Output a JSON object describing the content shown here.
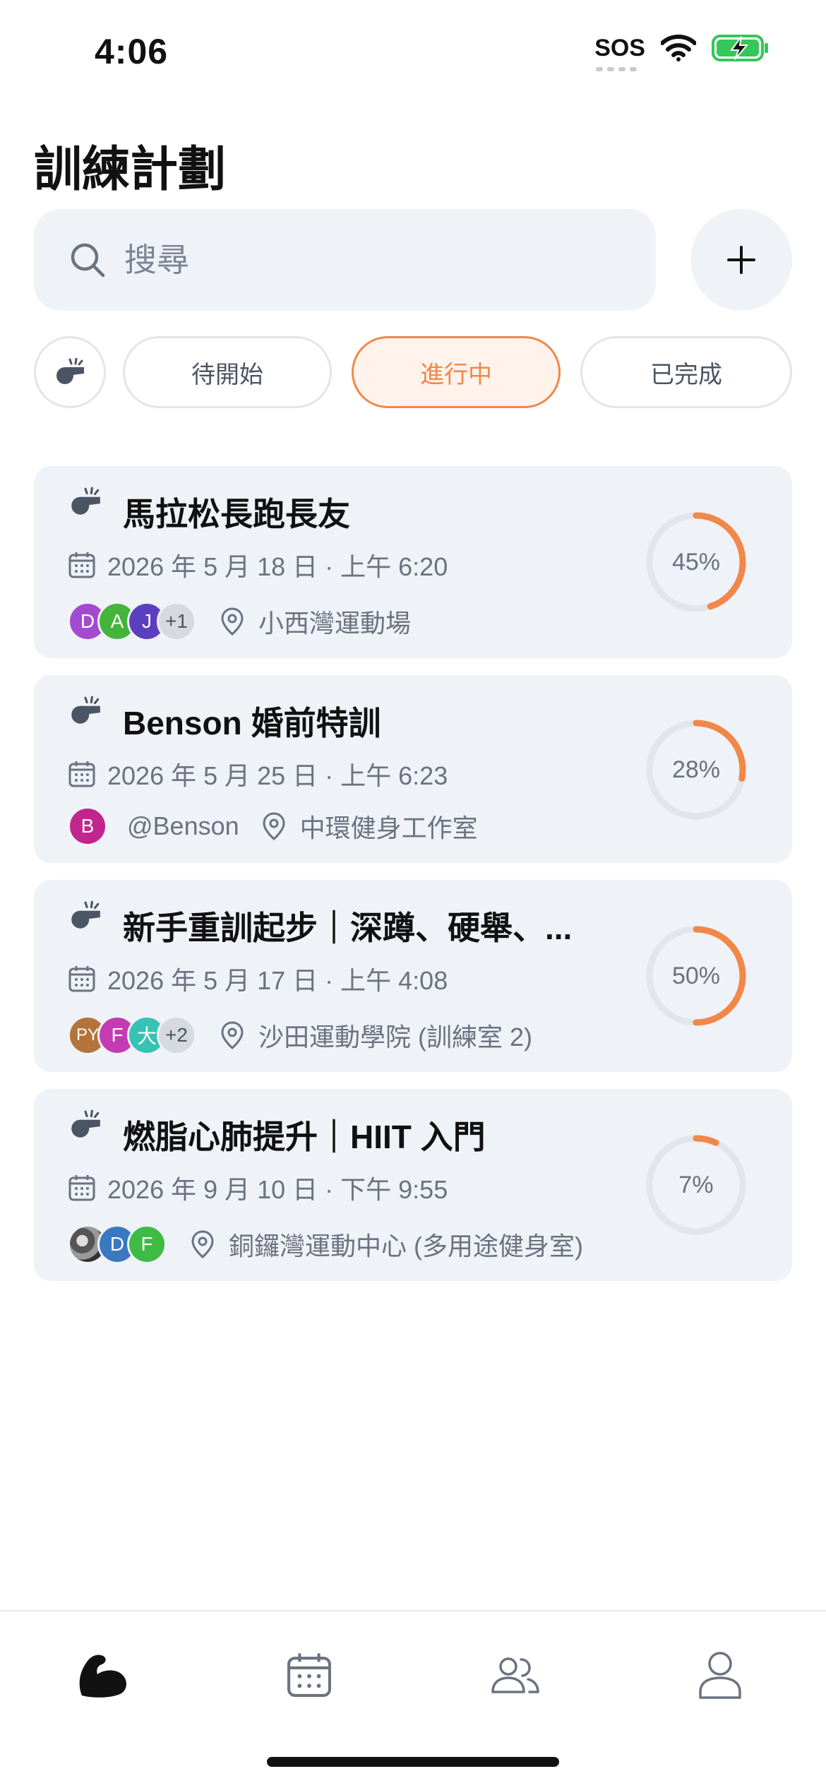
{
  "status_bar": {
    "time": "4:06",
    "sos": "SOS"
  },
  "page": {
    "title": "訓練計劃"
  },
  "search": {
    "placeholder": "搜尋",
    "value": ""
  },
  "filters": [
    {
      "label": "待開始",
      "active": false
    },
    {
      "label": "進行中",
      "active": true
    },
    {
      "label": "已完成",
      "active": false
    }
  ],
  "colors": {
    "accent": "#f2874a",
    "card_bg": "#eff2f7",
    "muted_text": "#6b7280",
    "ring_track": "#e2e5ea"
  },
  "plans": [
    {
      "title": "馬拉松長跑長友",
      "date": "2026 年 5 月 18 日 · 上午 6:20",
      "participants": [
        {
          "initial": "D",
          "color": "#a24bd0"
        },
        {
          "initial": "A",
          "color": "#45b43c"
        },
        {
          "initial": "J",
          "color": "#5c3fc0"
        }
      ],
      "more": "+1",
      "location": "小西灣運動場",
      "progress_label": "45%",
      "progress": 0.45
    },
    {
      "title": "Benson 婚前特訓",
      "date": "2026 年 5 月 25 日 · 上午 6:23",
      "participants": [
        {
          "initial": "B",
          "color": "#c0268e"
        }
      ],
      "handle": "@Benson",
      "location": "中環健身工作室",
      "progress_label": "28%",
      "progress": 0.28
    },
    {
      "title": "新手重訓起步｜深蹲、硬舉、...",
      "date": "2026 年 5 月 17 日 · 上午 4:08",
      "participants": [
        {
          "initial": "PY",
          "color": "#b3733a"
        },
        {
          "initial": "F",
          "color": "#c43bb3"
        },
        {
          "initial": "大",
          "color": "#36c2b4"
        }
      ],
      "more": "+2",
      "location": "沙田運動學院 (訓練室 2)",
      "progress_label": "50%",
      "progress": 0.5
    },
    {
      "title": "燃脂心肺提升｜HIIT 入門",
      "date": "2026 年 9 月 10 日 · 下午 9:55",
      "participants": [
        {
          "initial": "",
          "color": "#666666",
          "photo": true
        },
        {
          "initial": "D",
          "color": "#3a78c0"
        },
        {
          "initial": "F",
          "color": "#3dbb45"
        }
      ],
      "location": "銅鑼灣運動中心 (多用途健身室)",
      "progress_label": "7%",
      "progress": 0.07
    }
  ],
  "tabbar": {
    "items": [
      {
        "icon": "flexed-bicep-icon",
        "active": true
      },
      {
        "icon": "calendar-icon",
        "active": false
      },
      {
        "icon": "people-icon",
        "active": false
      },
      {
        "icon": "person-icon",
        "active": false
      }
    ]
  }
}
